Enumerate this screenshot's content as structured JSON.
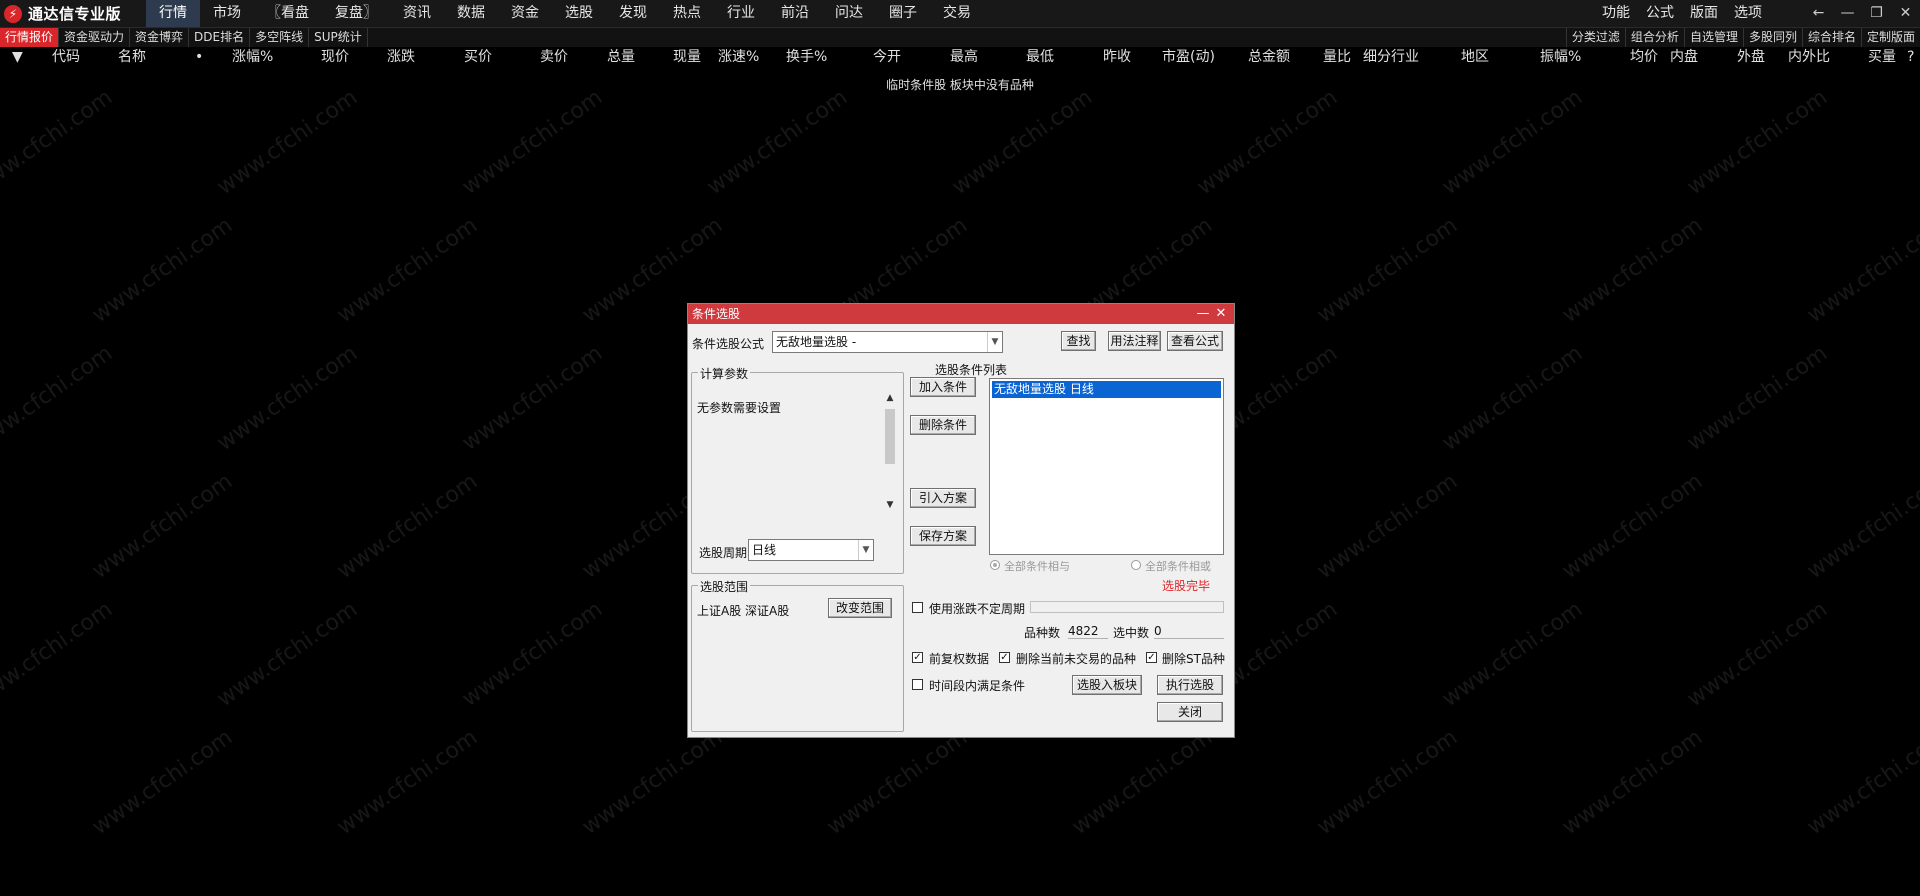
{
  "app": {
    "title": "通达信专业版",
    "logo_glyph": "⚡"
  },
  "menu": [
    "行情",
    "市场",
    "〖看盘",
    "复盘〗",
    "资讯",
    "数据",
    "资金",
    "选股",
    "发现",
    "热点",
    "行业",
    "前沿",
    "问达",
    "圈子",
    "交易"
  ],
  "right_menu": [
    "功能",
    "公式",
    "版面",
    "选项"
  ],
  "window_controls": [
    "←",
    "—",
    "❐",
    "✕"
  ],
  "toolbar_left": [
    "行情报价",
    "资金驱动力",
    "资金博弈",
    "DDE排名",
    "多空阵线",
    "SUP统计"
  ],
  "toolbar_right": [
    "分类过滤",
    "组合分析",
    "自选管理",
    "多股同列",
    "综合排名",
    "定制版面"
  ],
  "columns": [
    "▼",
    "代码",
    "名称",
    "•",
    "涨幅%",
    "现价",
    "涨跌",
    "买价",
    "卖价",
    "总量",
    "现量",
    "涨速%",
    "换手%",
    "今开",
    "最高",
    "最低",
    "昨收",
    "市盈(动)",
    "总金额",
    "量比",
    "细分行业",
    "地区",
    "振幅%",
    "均价",
    "内盘",
    "外盘",
    "内外比",
    "买量",
    "?"
  ],
  "empty_message": "临时条件股 板块中没有品种",
  "watermark": "www.cfchi.com",
  "dialog": {
    "title": "条件选股",
    "formula_label": "条件选股公式",
    "formula_value": "无敌地量选股 -",
    "btn_find": "查找",
    "btn_usage": "用法注释",
    "btn_view": "查看公式",
    "params_group": "计算参数",
    "params_text": "无参数需要设置",
    "period_label": "选股周期:",
    "period_value": "日线",
    "btn_add": "加入条件",
    "btn_delete": "删除条件",
    "btn_import": "引入方案",
    "btn_save": "保存方案",
    "list_label": "选股条件列表",
    "list_items": [
      "无敌地量选股  日线"
    ],
    "radio_and": "全部条件相与",
    "radio_or": "全部条件相或",
    "status": "选股完毕",
    "scope_group": "选股范围",
    "scope_text": "上证A股 深证A股",
    "btn_scope": "改变范围",
    "chk_period": "使用涨跌不定周期",
    "count_label": "品种数",
    "count_value": "4822",
    "selected_label": "选中数",
    "selected_value": "0",
    "chk_prefix": "前复权数据",
    "chk_remove_inactive": "删除当前未交易的品种",
    "chk_remove_st": "删除ST品种",
    "chk_timerange": "时间段内满足条件",
    "btn_to_block": "选股入板块",
    "btn_execute": "执行选股",
    "btn_close": "关闭",
    "accent_color": "#cf3a3f",
    "status_color": "#e0262a"
  }
}
